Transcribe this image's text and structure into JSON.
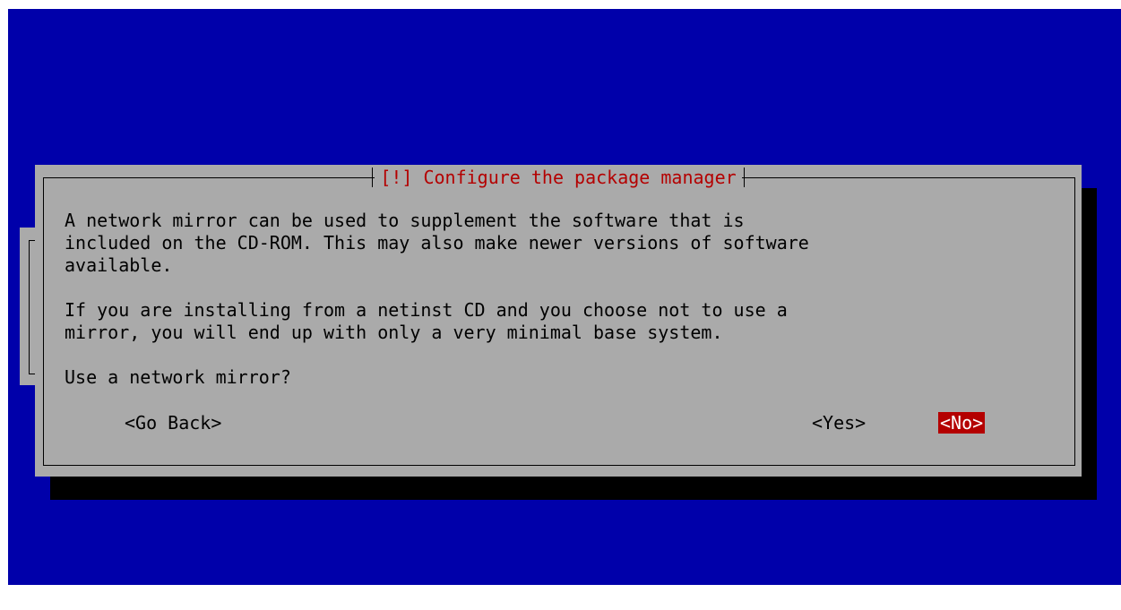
{
  "dialog": {
    "title": "[!] Configure the package manager",
    "paragraphs": [
      "A network mirror can be used to supplement the software that is\nincluded on the CD-ROM. This may also make newer versions of software\navailable.",
      "If you are installing from a netinst CD and you choose not to use a\nmirror, you will end up with only a very minimal base system.",
      "Use a network mirror?"
    ],
    "buttons": {
      "go_back": "<Go Back>",
      "yes": "<Yes>",
      "no": "<No>"
    },
    "selected_button": "no"
  },
  "colors": {
    "screen_background": "#0000aa",
    "dialog_background": "#aaaaaa",
    "title_text": "#b40000",
    "selected_button_background": "#b40000",
    "selected_button_text": "#ffffff",
    "shadow": "#000000"
  }
}
